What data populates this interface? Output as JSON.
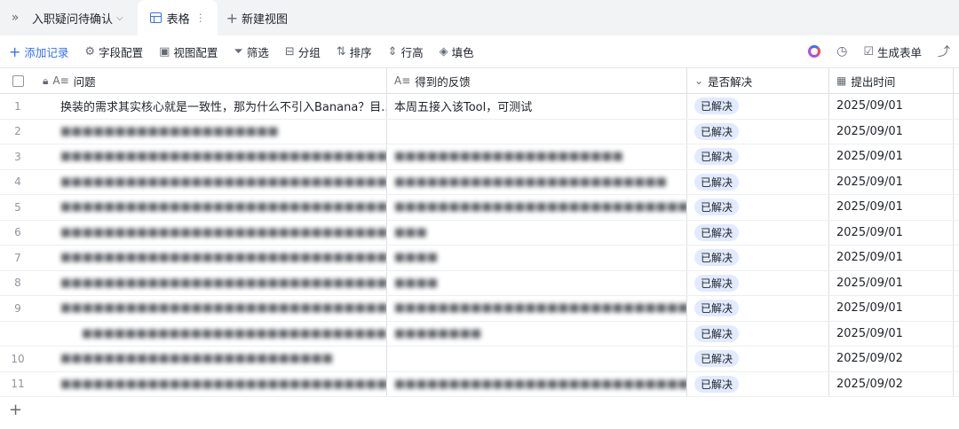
{
  "tabs": {
    "sidebar_toggle": "»",
    "base_name": "入职疑问待确认",
    "active_view": "表格",
    "new_view": "新建视图"
  },
  "toolbar": {
    "add_record": "添加记录",
    "field_config": "字段配置",
    "view_config": "视图配置",
    "filter": "筛选",
    "group": "分组",
    "sort": "排序",
    "row_height": "行高",
    "fill": "填色",
    "generate_form": "生成表单"
  },
  "columns": {
    "question": "问题",
    "feedback": "得到的反馈",
    "resolved": "是否解决",
    "date": "提出时间"
  },
  "rows": [
    {
      "idx": "1",
      "question": "换装的需求其实核心就是一致性，那为什么不引入Banana？目...",
      "feedback": "本周五接入该Tool，可测试",
      "status": "已解决",
      "date": "2025/09/01",
      "blurred": false
    },
    {
      "idx": "2",
      "question": "■■■■■■■■■■■■■■■■■■■■",
      "feedback": "",
      "status": "已解决",
      "date": "2025/09/01",
      "blurred": true
    },
    {
      "idx": "3",
      "question": "■■■■■■■■■■■■■■■■■■■■■■■■■■■■■■■",
      "feedback": "■■■■■■■■■■■■■■■■■■■■■",
      "status": "已解决",
      "date": "2025/09/01",
      "blurred": true
    },
    {
      "idx": "4",
      "question": "■■■■■■■■■■■■■■■■■■■■■■■■■■■■■■■■■",
      "feedback": "■■■■■■■■■■■■■■■■■■■■■■■■■",
      "status": "已解决",
      "date": "2025/09/01",
      "blurred": true
    },
    {
      "idx": "5",
      "question": "■■■■■■■■■■■■■■■■■■■■■■■■■■■■■■■■■■■■■■■",
      "feedback": "■■■■■■■■■■■■■■■■■■■■■■■■■■■■■■■■■■■■",
      "status": "已解决",
      "date": "2025/09/01",
      "blurred": true
    },
    {
      "idx": "6",
      "question": "■■■■■■■■■■■■■■■■■■■■■■■■■■■■■■■■■■■■■■■",
      "feedback": "■■■",
      "status": "已解决",
      "date": "2025/09/01",
      "blurred": true
    },
    {
      "idx": "7",
      "question": "■■■■■■■■■■■■■■■■■■■■■■■■■■■■■■■■",
      "feedback": "■■■■",
      "status": "已解决",
      "date": "2025/09/01",
      "blurred": true
    },
    {
      "idx": "8",
      "question": "■■■■■■■■■■■■■■■■■■■■■■■■■■■■■■■■■■■■■■",
      "feedback": "■■■■",
      "status": "已解决",
      "date": "2025/09/01",
      "blurred": true
    },
    {
      "idx": "9",
      "question": "■■■■■■■■■■■■■■■■■■■■■■■■■■■■■■■■■■■■■■",
      "feedback": "■■■■■■■■■■■■■■■■■■■■■■■■■■■■■■■■■",
      "status": "已解决",
      "date": "2025/09/01",
      "blurred": true,
      "expandable": true
    },
    {
      "idx": "",
      "question": "■■■■■■■■■■■■■■■■■■■■■■■■■■■■",
      "feedback": "■■■■■■■■",
      "status": "已解决",
      "date": "2025/09/01",
      "blurred": true,
      "indent": true
    },
    {
      "idx": "10",
      "question": "■■■■■■■■■■■■■■■■■■■■■■■■■",
      "feedback": "",
      "status": "已解决",
      "date": "2025/09/02",
      "blurred": true
    },
    {
      "idx": "11",
      "question": "■■■■■■■■■■■■■■■■■■■■■■■■■■■■■■■■■■■■",
      "feedback": "■■■■■■■■■■■■■■■■■■■■■■■■■■■■■■■■■■■■",
      "status": "已解决",
      "date": "2025/09/02",
      "blurred": true
    }
  ],
  "add_row": "+"
}
